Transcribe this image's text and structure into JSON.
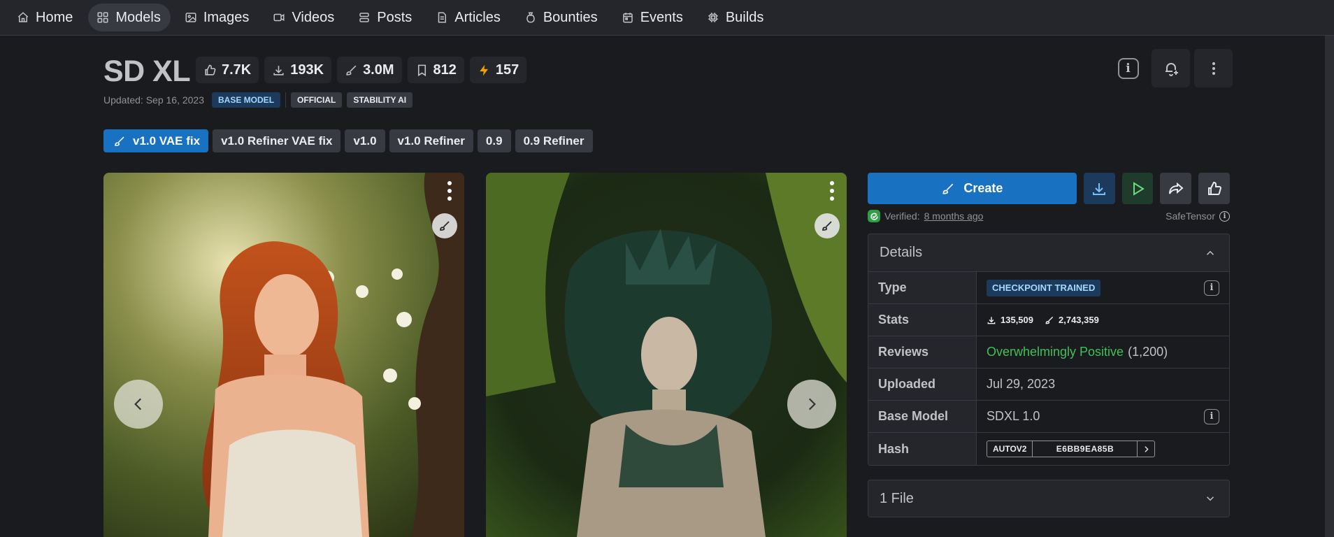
{
  "nav": {
    "items": [
      {
        "label": "Home",
        "icon": "home-icon"
      },
      {
        "label": "Models",
        "icon": "grid-icon",
        "active": true
      },
      {
        "label": "Images",
        "icon": "image-icon"
      },
      {
        "label": "Videos",
        "icon": "video-icon"
      },
      {
        "label": "Posts",
        "icon": "posts-icon"
      },
      {
        "label": "Articles",
        "icon": "article-icon"
      },
      {
        "label": "Bounties",
        "icon": "moneybag-icon"
      },
      {
        "label": "Events",
        "icon": "calendar-icon"
      },
      {
        "label": "Builds",
        "icon": "cpu-icon"
      }
    ]
  },
  "model": {
    "title": "SD XL",
    "stats": {
      "likes": "7.7K",
      "downloads": "193K",
      "generations": "3.0M",
      "bookmarks": "812",
      "buzz": "157"
    },
    "updated": "Updated: Sep 16, 2023",
    "badges": [
      "BASE MODEL",
      "OFFICIAL",
      "STABILITY AI"
    ]
  },
  "versions": [
    {
      "label": "v1.0 VAE fix",
      "active": true
    },
    {
      "label": "v1.0 Refiner VAE fix"
    },
    {
      "label": "v1.0"
    },
    {
      "label": "v1.0 Refiner"
    },
    {
      "label": "0.9"
    },
    {
      "label": "0.9 Refiner"
    }
  ],
  "sidebar": {
    "create_label": "Create",
    "verified_prefix": "Verified:",
    "verified_link": "8 months ago",
    "format": "SafeTensor",
    "details_title": "Details",
    "details": {
      "type_key": "Type",
      "type_val": "CHECKPOINT TRAINED",
      "stats_key": "Stats",
      "stats_downloads": "135,509",
      "stats_generations": "2,743,359",
      "reviews_key": "Reviews",
      "reviews_val": "Overwhelmingly Positive",
      "reviews_count": "(1,200)",
      "uploaded_key": "Uploaded",
      "uploaded_val": "Jul 29, 2023",
      "base_key": "Base Model",
      "base_val": "SDXL 1.0",
      "hash_key": "Hash",
      "hash_algo": "AUTOV2",
      "hash_val": "E6BB9EA85B"
    },
    "files_label": "1 File"
  },
  "colors": {
    "background": "#1a1b1e",
    "surface": "#25262b",
    "accent": "#1971c2",
    "positive": "#40c057",
    "buzz": "#f59f00"
  }
}
